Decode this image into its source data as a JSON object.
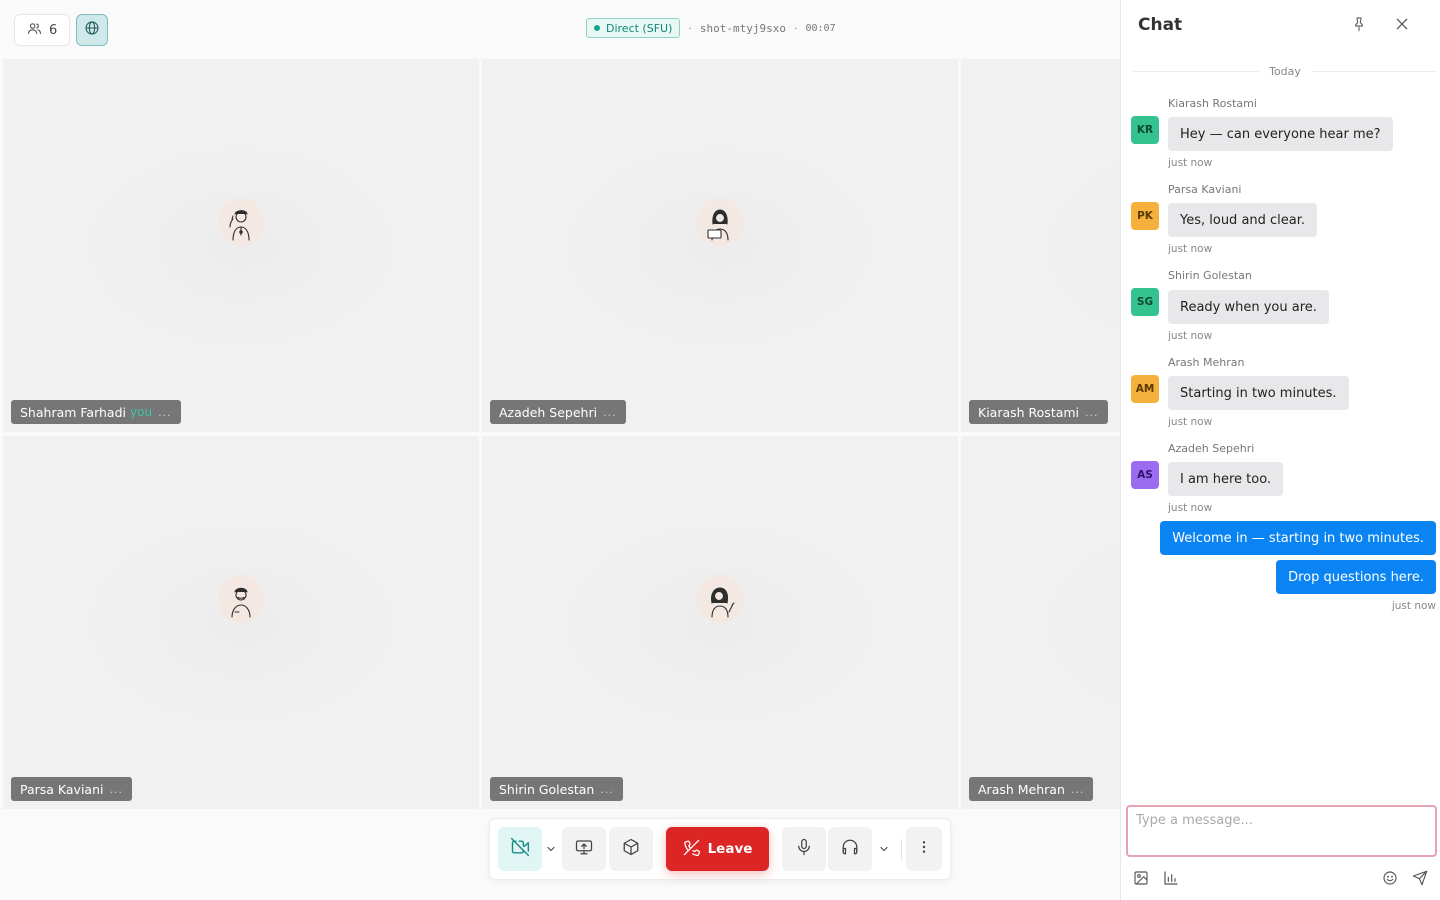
{
  "topbar": {
    "participant_count": "6",
    "connection_badge": "Direct (SFU)",
    "separator": "·",
    "room_id": "shot-mtyj9sxo",
    "timer": "00:07"
  },
  "tiles": [
    {
      "name": "Shahram Farhadi",
      "you_label": "you",
      "dots": "..."
    },
    {
      "name": "Azadeh Sepehri",
      "dots": "..."
    },
    {
      "name": "Kiarash Rostami",
      "dots": "..."
    },
    {
      "name": "Parsa Kaviani",
      "dots": "..."
    },
    {
      "name": "Shirin Golestan",
      "dots": "..."
    },
    {
      "name": "Arash Mehran",
      "dots": "..."
    }
  ],
  "controls": {
    "leave_label": "Leave"
  },
  "chat": {
    "title": "Chat",
    "day_separator": "Today",
    "messages": [
      {
        "sender": "Kiarash Rostami",
        "initials": "KR",
        "text": "Hey — can everyone hear me?",
        "time": "just now",
        "avatar_color": "#34c28f"
      },
      {
        "sender": "Parsa Kaviani",
        "initials": "PK",
        "text": "Yes, loud and clear.",
        "time": "just now",
        "avatar_color": "#f5b13b"
      },
      {
        "sender": "Shirin Golestan",
        "initials": "SG",
        "text": "Ready when you are.",
        "time": "just now",
        "avatar_color": "#34c28f"
      },
      {
        "sender": "Arash Mehran",
        "initials": "AM",
        "text": "Starting in two minutes.",
        "time": "just now",
        "avatar_color": "#f5b13b"
      },
      {
        "sender": "Azadeh Sepehri",
        "initials": "AS",
        "text": "I am here too.",
        "time": "just now",
        "avatar_color": "#9b6cf0"
      }
    ],
    "own_messages": [
      {
        "text": "Welcome in — starting in two minutes."
      },
      {
        "text": "Drop questions here."
      }
    ],
    "own_time": "just now",
    "composer_placeholder": "Type a message..."
  },
  "colors": {
    "accent_teal": "#10a88c",
    "leave_red": "#dc2626",
    "own_bubble_blue": "#0a84f2",
    "composer_border": "#e8a3b3"
  },
  "icons": [
    "users-icon",
    "globe-icon",
    "camera-off-icon",
    "chevron-down-icon",
    "screen-share-icon",
    "cube-icon",
    "phone-off-icon",
    "microphone-icon",
    "headphones-icon",
    "more-vertical-icon",
    "pin-icon",
    "close-icon",
    "image-icon",
    "poll-icon",
    "emoji-icon",
    "send-icon"
  ]
}
